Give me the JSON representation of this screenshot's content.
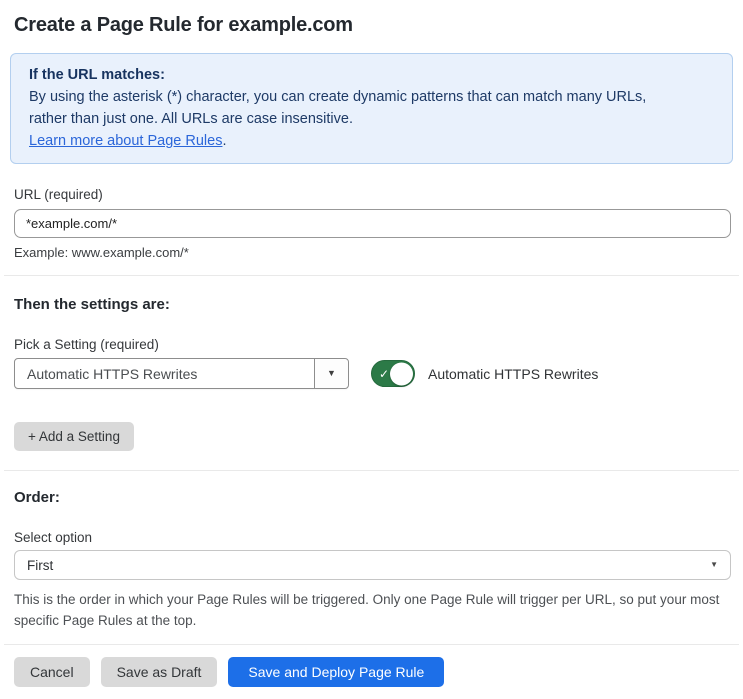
{
  "page": {
    "title": "Create a Page Rule for example.com"
  },
  "info_box": {
    "heading": "If the URL matches:",
    "line1": "By using the asterisk (*) character, you can create dynamic patterns that can match many URLs,",
    "line2": "rather than just one. All URLs are case insensitive.",
    "link_label": "Learn more about Page Rules",
    "link_suffix": "."
  },
  "url_section": {
    "label": "URL (required)",
    "input_value": "*example.com/*",
    "helper": "Example: www.example.com/*"
  },
  "settings_section": {
    "heading": "Then the settings are:",
    "picker_label": "Pick a Setting (required)",
    "selected_setting": "Automatic HTTPS Rewrites",
    "toggle_label": "Automatic HTTPS Rewrites",
    "toggle_state": "on",
    "add_setting_label": "+ Add a Setting"
  },
  "order_section": {
    "heading": "Order:",
    "select_label": "Select option",
    "selected_option": "First",
    "helper": "This is the order in which your Page Rules will be triggered. Only one Page Rule will trigger per URL, so put your most specific Page Rules at the top."
  },
  "footer": {
    "cancel_label": "Cancel",
    "save_draft_label": "Save as Draft",
    "save_deploy_label": "Save and Deploy Page Rule"
  },
  "icons": {
    "dropdown_chevron": "▼",
    "select_chevron": "▼",
    "toggle_check": "✓"
  },
  "colors": {
    "primary_blue": "#1d6fe8",
    "toggle_green": "#2c7a47",
    "info_background": "#e9f1fc",
    "info_border": "#b3cfef",
    "info_text": "#1e3a66",
    "link_blue": "#2b66d9",
    "gray_button": "#d9d9d9"
  }
}
